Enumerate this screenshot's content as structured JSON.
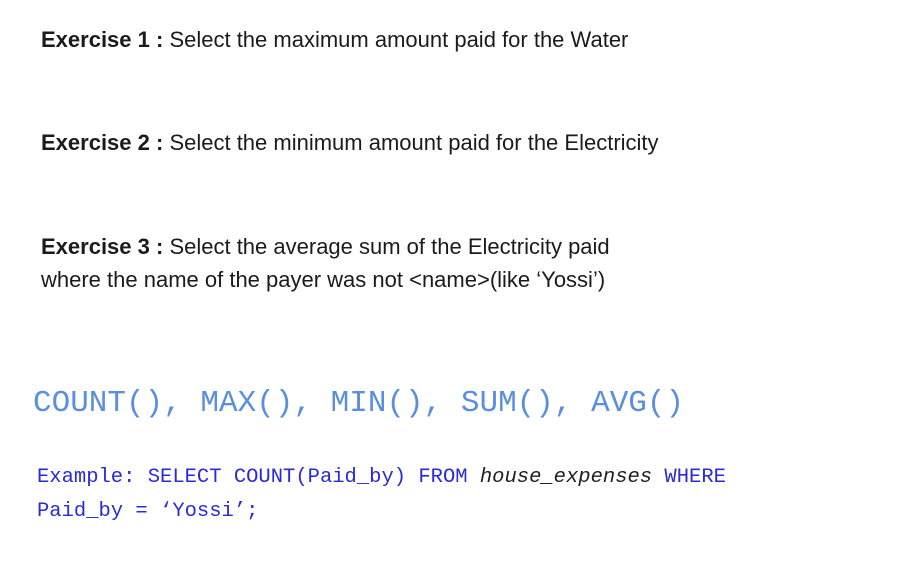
{
  "exercises": [
    {
      "label": "Exercise 1",
      "colon": ":",
      "text": " Select the maximum amount paid for the Water"
    },
    {
      "label": "Exercise 2",
      "colon": ":",
      "text": " Select the minimum amount paid for the Electricity"
    },
    {
      "label": "Exercise 3",
      "colon": ":",
      "text_line1": " Select the average sum of the Electricity paid",
      "text_line2": "where the name of the payer was not <name>(like ‘Yossi’)"
    }
  ],
  "functions_line": "COUNT(), MAX(), MIN(), SUM(), AVG()",
  "example": {
    "prefix": "Example: SELECT COUNT(Paid_by) FROM ",
    "table": "house_expenses",
    "suffix": " WHERE\nPaid_by = ‘Yossi’;"
  },
  "colors": {
    "functions": "#5a8ee0",
    "example": "#2a2ad8",
    "text": "#1b1b1b"
  }
}
